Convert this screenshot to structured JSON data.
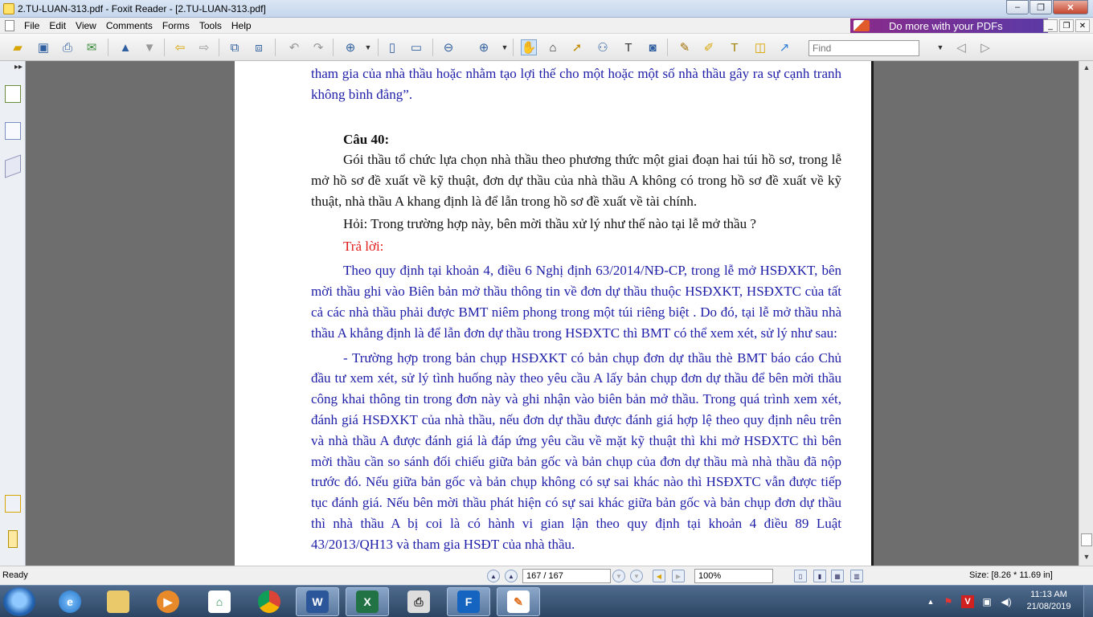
{
  "window": {
    "title": "2.TU-LUAN-313.pdf - Foxit Reader - [2.TU-LUAN-313.pdf]",
    "minimize": "–",
    "maximize": "❐",
    "close": "✕"
  },
  "menu": {
    "items": [
      "File",
      "Edit",
      "View",
      "Comments",
      "Forms",
      "Tools",
      "Help"
    ]
  },
  "promo": {
    "text": "Do more with your PDFs"
  },
  "toolbar": {
    "find_placeholder": "Find"
  },
  "document": {
    "paragraphs": [
      {
        "style": "blue",
        "indent": false,
        "text": "tham gia của nhà thầu hoặc nhằm tạo lợi thế cho một hoặc một số nhà thầu gây ra sự cạnh tranh không bình đẳng”."
      },
      {
        "style": "black bold",
        "indent": true,
        "text": "Câu 40:"
      },
      {
        "style": "black",
        "indent": true,
        "text": "Gói thầu tổ chức lựa chọn nhà thầu theo phương thức một giai đoạn hai túi hồ sơ, trong lễ mở hồ sơ đề xuất về kỹ thuật, đơn dự thầu của nhà thầu A không có trong hồ sơ đề xuất về kỹ thuật, nhà thầu A khang định là để lẫn trong hồ sơ đề xuất về tài chính."
      },
      {
        "style": "black",
        "indent": true,
        "text": "Hỏi: Trong trường hợp này, bên mời thầu xử lý như thế nào tại lễ mở thầu ?"
      },
      {
        "style": "red",
        "indent": true,
        "text": "Trả lời:"
      },
      {
        "style": "blue",
        "indent": true,
        "text": "Theo quy định tại khoản 4, điều 6 Nghị định 63/2014/NĐ-CP, trong lễ mở HSĐXKT, bên mời thầu ghi vào Biên bản mở thầu thông tin về đơn dự thầu thuộc HSĐXKT, HSĐXTC của tất cả các nhà thầu phải được BMT niêm phong trong một túi riêng biệt . Do đó, tại lễ mở thầu nhà thầu A khẳng định là để lẫn đơn dự thầu trong HSĐXTC thì BMT có thể xem xét, sử lý như sau:"
      },
      {
        "style": "blue",
        "indent": true,
        "text": "- Trường hợp trong bản chụp HSĐXKT có bản chụp đơn dự thầu thè BMT báo cáo Chủ đầu tư xem xét, sử lý tình huống này theo yêu cầu A lấy bản chụp đơn dự thầu để bên mời thầu công khai thông tin trong đơn này và ghi nhận vào biên bản mở thầu. Trong quá trình xem xét, đánh giá HSĐXKT của nhà thầu, nếu đơn dự thầu được đánh giá hợp lệ theo quy định nêu trên và nhà thầu A được đánh giá là đáp ứng yêu cầu về mặt kỹ thuật thì khi mở HSĐXTC thì bên mời thầu cần so sánh đối chiếu giữa bản gốc và bản chụp của đơn dự thầu mà nhà thầu đã nộp trước đó. Nếu giữa bản gốc và bản chụp không có sự sai khác nào thì HSĐXTC vẫn được tiếp tục đánh giá. Nếu bên mời thầu phát hiện có sự sai khác giữa bản gốc và bản chụp đơn dự thầu thì nhà thầu A bị coi là có hành vi gian lận theo quy định tại khoản 4 điều 89 Luật 43/2013/QH13 và tham gia HSĐT của nhà thầu."
      }
    ]
  },
  "statusbar": {
    "status": "Ready",
    "page_display": "167 / 167",
    "zoom": "100%",
    "page_size": "Size: [8.26 * 11.69 in]"
  },
  "taskbar": {
    "apps": [
      "folder-app",
      "media-player",
      "home-app",
      "chrome",
      "word",
      "excel",
      "printer-app",
      "foxit-app",
      "foxit-reader"
    ],
    "clock_time": "11:13 AM",
    "clock_date": "21/08/2019"
  },
  "colors": {
    "doc_blue": "#1d1da8",
    "doc_red": "#e31b1b",
    "promo_purple": "#6b2f9a"
  }
}
